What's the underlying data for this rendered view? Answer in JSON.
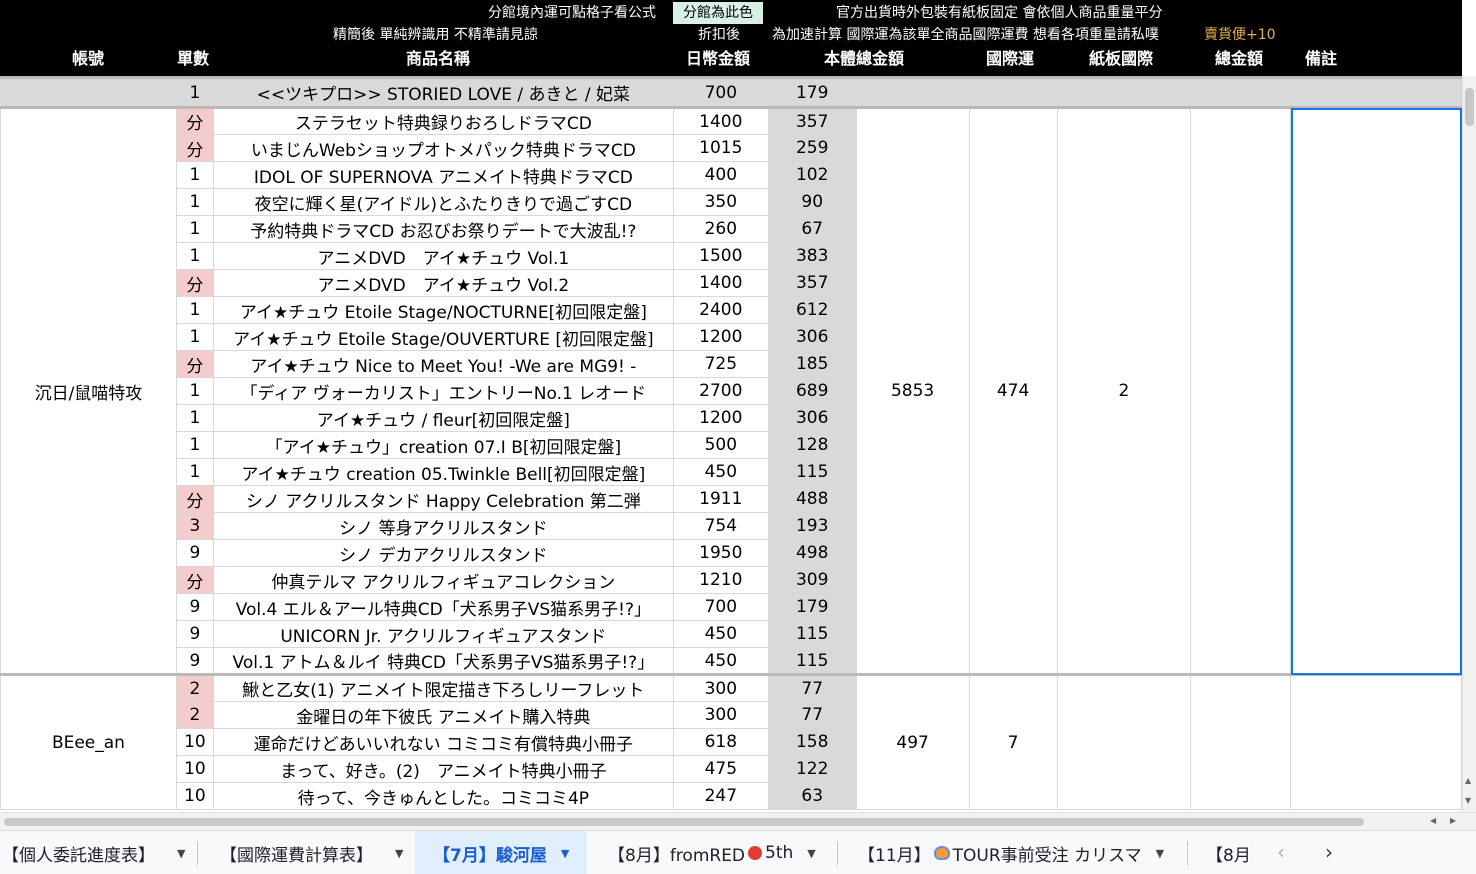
{
  "header": {
    "note_formula": "分館境內運可點格子看公式",
    "note_branch": "分館為此色",
    "note_cardboard": "官方出貨時外包裝有紙板固定 會依個人商品重量平分",
    "note_simplified": "精簡後 單純辨識用 不精準請見諒",
    "note_discount": "折扣後",
    "note_intl": "為加速計算 國際運為該單全商品國際運費 想看各項重量請私噗",
    "note_shipping": "賣貨便+10",
    "columns": {
      "account": "帳號",
      "qty": "單數",
      "item": "商品名稱",
      "jpy": "日幣金額",
      "subtotal": "本體總金額",
      "intl": "國際運",
      "cardboard": "紙板國際",
      "total": "總金額",
      "remark": "備註"
    }
  },
  "rows": {
    "first": {
      "qty": "1",
      "item": "<<ツキプロ>> STORIED LOVE / あきと / 妃菜",
      "jpy": "700",
      "tw": "179"
    },
    "group1": {
      "account": "沉日/鼠喵特攻",
      "subtotal": "5853",
      "intl": "474",
      "cardboard": "2",
      "items": [
        {
          "qty": "分",
          "item": "ステラセット特典録りおろしドラマCD",
          "jpy": "1400",
          "tw": "357"
        },
        {
          "qty": "分",
          "item": "いまじんWebショップオトメパック特典ドラマCD",
          "jpy": "1015",
          "tw": "259"
        },
        {
          "qty": "1",
          "item": "IDOL OF SUPERNOVA アニメイト特典ドラマCD",
          "jpy": "400",
          "tw": "102"
        },
        {
          "qty": "1",
          "item": "夜空に輝く星(アイドル)とふたりきりで過ごすCD",
          "jpy": "350",
          "tw": "90"
        },
        {
          "qty": "1",
          "item": "予約特典ドラマCD お忍びお祭りデートで大波乱!?",
          "jpy": "260",
          "tw": "67"
        },
        {
          "qty": "1",
          "item": "アニメDVD　アイ★チュウ Vol.1",
          "jpy": "1500",
          "tw": "383"
        },
        {
          "qty": "分",
          "item": "アニメDVD　アイ★チュウ Vol.2",
          "jpy": "1400",
          "tw": "357"
        },
        {
          "qty": "1",
          "item": "アイ★チュウ Etoile Stage/NOCTURNE[初回限定盤]",
          "jpy": "2400",
          "tw": "612"
        },
        {
          "qty": "1",
          "item": "アイ★チュウ Etoile Stage/OUVERTURE [初回限定盤]",
          "jpy": "1200",
          "tw": "306"
        },
        {
          "qty": "分",
          "item": "アイ★チュウ Nice to Meet You! -We are MG9! -",
          "jpy": "725",
          "tw": "185"
        },
        {
          "qty": "1",
          "item": "「ディア ヴォーカリスト」エントリーNo.1 レオード",
          "jpy": "2700",
          "tw": "689"
        },
        {
          "qty": "1",
          "item": "アイ★チュウ / fleur[初回限定盤]",
          "jpy": "1200",
          "tw": "306"
        },
        {
          "qty": "1",
          "item": "「アイ★チュウ」creation 07.I B[初回限定盤]",
          "jpy": "500",
          "tw": "128"
        },
        {
          "qty": "1",
          "item": "アイ★チュウ creation 05.Twinkle Bell[初回限定盤]",
          "jpy": "450",
          "tw": "115"
        },
        {
          "qty": "分",
          "item": "シノ アクリルスタンド Happy Celebration 第二弾",
          "jpy": "1911",
          "tw": "488"
        },
        {
          "qty": "3",
          "item": "シノ 等身アクリルスタンド",
          "jpy": "754",
          "tw": "193"
        },
        {
          "qty": "9",
          "item": "シノ デカアクリルスタンド",
          "jpy": "1950",
          "tw": "498"
        },
        {
          "qty": "分",
          "item": "仲真テルマ アクリルフィギュアコレクション",
          "jpy": "1210",
          "tw": "309"
        },
        {
          "qty": "9",
          "item": "Vol.4 エル＆アール特典CD「犬系男子VS猫系男子!?」",
          "jpy": "700",
          "tw": "179"
        },
        {
          "qty": "9",
          "item": "UNICORN Jr. アクリルフィギュアスタンド",
          "jpy": "450",
          "tw": "115"
        },
        {
          "qty": "9",
          "item": "Vol.1 アトム＆ルイ 特典CD「犬系男子VS猫系男子!?」",
          "jpy": "450",
          "tw": "115"
        }
      ]
    },
    "group2": {
      "account": "BEee_an",
      "subtotal": "497",
      "intl": "7",
      "items": [
        {
          "qty": "2",
          "item": "鰍と乙女(1) アニメイト限定描き下ろしリーフレット",
          "jpy": "300",
          "tw": "77"
        },
        {
          "qty": "2",
          "item": "金曜日の年下彼氏 アニメイト購入特典",
          "jpy": "300",
          "tw": "77"
        },
        {
          "qty": "10",
          "item": "運命だけどあいいれない コミコミ有償特典小冊子",
          "jpy": "618",
          "tw": "158"
        },
        {
          "qty": "10",
          "item": "まって、好き。(2)　アニメイト特典小冊子",
          "jpy": "475",
          "tw": "122"
        },
        {
          "qty": "10",
          "item": "待って、今きゅんとした。コミコミ4P",
          "jpy": "247",
          "tw": "63"
        }
      ]
    }
  },
  "tabs": [
    {
      "label": "【個人委託進度表】"
    },
    {
      "label": "【國際運費計算表】"
    },
    {
      "label": "【7月】駿河屋"
    },
    {
      "label": "【8月】fromRED",
      "suffix": "5th"
    },
    {
      "label": "【11月】",
      "suffix": "TOUR事前受注 カリスマ"
    },
    {
      "label": "【8月】"
    }
  ],
  "icons": {
    "tab_menu": "chevron-down-icon",
    "tab_prev": "chevron-left-icon",
    "tab_next": "chevron-right-icon",
    "red_dot": "red-circle-icon",
    "tour": "tour-emoji-icon"
  },
  "colors": {
    "header_bg": "#000000",
    "branch_highlight": "#d9f0e5",
    "split_qty": "#f4cccc",
    "twd_column": "#d9d9d9",
    "shipping_note": "#e8b04a",
    "active_tab": "#1a5fd1",
    "selection": "#1a73e8"
  }
}
